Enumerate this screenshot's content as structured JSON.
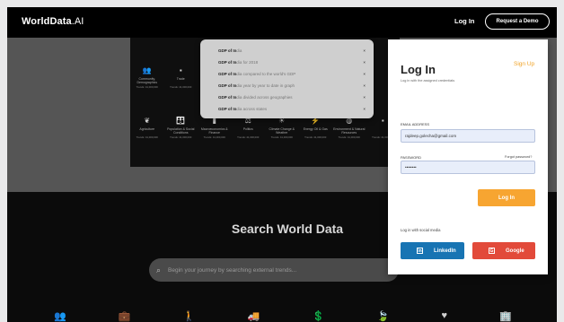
{
  "header": {
    "logo_main": "WorldData",
    "logo_suffix": ".AI",
    "login_label": "Log In",
    "demo_label": "Request a Demo"
  },
  "hero": {
    "row1": [
      {
        "icon": "people-icon",
        "glyph": "👥",
        "name": "Community, Demographics",
        "tag": "Trends: 41,000,000"
      },
      {
        "icon": "briefcase-icon",
        "glyph": "▪",
        "name": "Trade",
        "tag": "Trends: 41,000,000"
      },
      {
        "icon": "",
        "glyph": "",
        "name": "",
        "tag": ""
      },
      {
        "icon": "",
        "glyph": "",
        "name": "",
        "tag": ""
      },
      {
        "icon": "",
        "glyph": "",
        "name": "",
        "tag": ""
      },
      {
        "icon": "",
        "glyph": "",
        "name": "",
        "tag": ""
      },
      {
        "icon": "",
        "glyph": "",
        "name": "",
        "tag": ""
      },
      {
        "icon": "",
        "glyph": "",
        "name": "",
        "tag": ""
      }
    ],
    "row2": [
      {
        "icon": "leaf-icon",
        "glyph": "❦",
        "name": "Agriculture",
        "tag": "Trends: 41,000,000"
      },
      {
        "icon": "group-icon",
        "glyph": "👪",
        "name": "Population & Social Conditions",
        "tag": "Trends: 41,000,000"
      },
      {
        "icon": "bar-chart-icon",
        "glyph": "▮",
        "name": "Macroeconomics & Finance",
        "tag": "Trends: 41,000,000"
      },
      {
        "icon": "gavel-icon",
        "glyph": "⚖",
        "name": "Politics",
        "tag": "Trends: 41,000,000"
      },
      {
        "icon": "sun-icon",
        "glyph": "☀",
        "name": "Climate Change & Weather",
        "tag": "Trends: 41,000,000"
      },
      {
        "icon": "energy-icon",
        "glyph": "⚡",
        "name": "Energy Oil & Gas",
        "tag": "Trends: 41,000,000"
      },
      {
        "icon": "globe-icon",
        "glyph": "◍",
        "name": "Environment & Natural Resources",
        "tag": "Trends: 41,000,000"
      },
      {
        "icon": "extra-icon",
        "glyph": "▪",
        "name": "",
        "tag": "Trends: 41,000,000"
      }
    ]
  },
  "dropdown": {
    "items": [
      {
        "bold": "GDP of In",
        "rest": "dia",
        "close": "×"
      },
      {
        "bold": "GDP of In",
        "rest": "dia for 2018",
        "close": "×"
      },
      {
        "bold": "GDP of In",
        "rest": "dia compared to the world's GDP",
        "close": "×"
      },
      {
        "bold": "GDP of In",
        "rest": "dia year by year to date in graph",
        "close": "×"
      },
      {
        "bold": "GDP of In",
        "rest": "dia divided across geographies",
        "close": "×"
      },
      {
        "bold": "GDP of In",
        "rest": "dia across states",
        "close": "×"
      }
    ]
  },
  "search": {
    "title": "Search World Data",
    "placeholder": "Begin your journey by searching external trends..."
  },
  "bottom_icons": [
    "people-icon",
    "briefcase-icon",
    "person-icon",
    "truck-icon",
    "money-icon",
    "leaf-icon",
    "heart-icon",
    "building-icon"
  ],
  "login": {
    "title": "Log In",
    "signup": "Sign Up",
    "subtitle": "Log in with the assigned credentials",
    "email_label": "EMAIL ADDRESS",
    "email_value": "rajdeep.golecha@gmail.com",
    "password_label": "PASSWORD",
    "password_value": "••••••••",
    "forgot": "Forgot password?",
    "button": "Log In",
    "social_label": "Log in with social media",
    "linkedin": "LinkedIn",
    "google": "Google"
  }
}
